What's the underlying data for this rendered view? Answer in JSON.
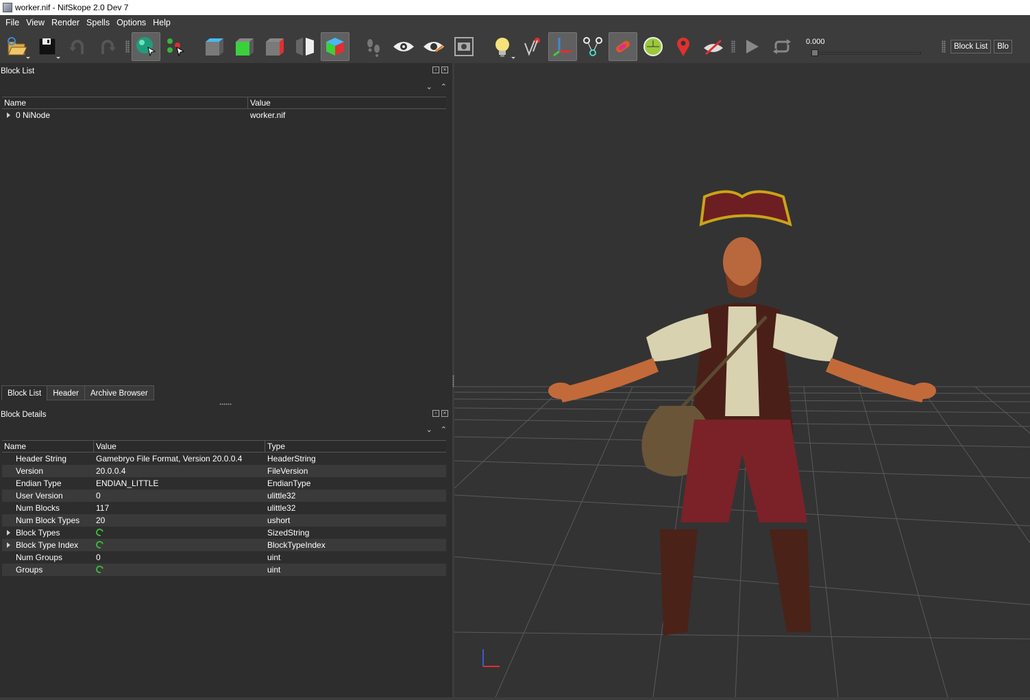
{
  "window": {
    "title": "worker.nif - NifSkope 2.0 Dev 7"
  },
  "menubar": [
    "File",
    "View",
    "Render",
    "Spells",
    "Options",
    "Help"
  ],
  "toolbar": {
    "time_value": "0.000",
    "block_list_button": "Block List",
    "block_details_button_truncated": "Blo"
  },
  "block_list": {
    "title": "Block List",
    "columns": [
      "Name",
      "Value"
    ],
    "rows": [
      {
        "name": "0 NiNode",
        "value": "worker.nif",
        "expandable": true
      }
    ]
  },
  "tabs": [
    "Block List",
    "Header",
    "Archive Browser"
  ],
  "block_details": {
    "title": "Block Details",
    "columns": [
      "Name",
      "Value",
      "Type"
    ],
    "rows": [
      {
        "name": "Header String",
        "value": "Gamebryo File Format, Version 20.0.0.4",
        "type": "HeaderString",
        "expandable": false,
        "refresh": false
      },
      {
        "name": "Version",
        "value": "20.0.0.4",
        "type": "FileVersion",
        "expandable": false,
        "refresh": false
      },
      {
        "name": "Endian Type",
        "value": "ENDIAN_LITTLE",
        "type": "EndianType",
        "expandable": false,
        "refresh": false
      },
      {
        "name": "User Version",
        "value": "0",
        "type": "ulittle32",
        "expandable": false,
        "refresh": false
      },
      {
        "name": "Num Blocks",
        "value": "117",
        "type": "ulittle32",
        "expandable": false,
        "refresh": false
      },
      {
        "name": "Num Block Types",
        "value": "20",
        "type": "ushort",
        "expandable": false,
        "refresh": false
      },
      {
        "name": "Block Types",
        "value": "",
        "type": "SizedString",
        "expandable": true,
        "refresh": true
      },
      {
        "name": "Block Type Index",
        "value": "",
        "type": "BlockTypeIndex",
        "expandable": true,
        "refresh": true
      },
      {
        "name": "Num Groups",
        "value": "0",
        "type": "uint",
        "expandable": false,
        "refresh": false
      },
      {
        "name": "Groups",
        "value": "",
        "type": "uint",
        "expandable": false,
        "refresh": true
      }
    ]
  },
  "colors": {
    "background": "#2d2d2d",
    "viewport": "#333333",
    "toolbar": "#3c3c3c",
    "refresh_icon": "#3cb43c"
  }
}
